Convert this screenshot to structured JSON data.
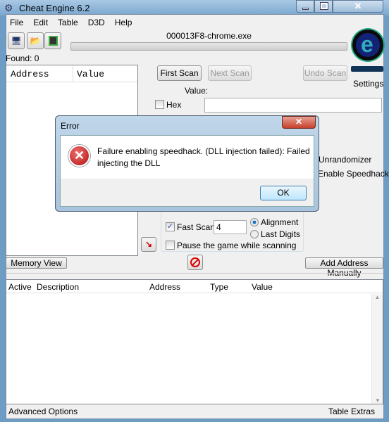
{
  "window": {
    "title": "Cheat Engine 6.2",
    "controls": [
      "minimize",
      "maximize",
      "close"
    ]
  },
  "menu": [
    "File",
    "Edit",
    "Table",
    "D3D",
    "Help"
  ],
  "process": "000013F8-chrome.exe",
  "progress": 0,
  "found": "Found: 0",
  "results_columns": [
    "Address",
    "Value"
  ],
  "scan": {
    "first": "First Scan",
    "next": "Next Scan",
    "undo": "Undo Scan",
    "value_label": "Value:",
    "hex": "Hex",
    "settings": "Settings",
    "unrandomizer": "Unrandomizer",
    "speedhack": "Enable Speedhack",
    "fast_scan": "Fast Scan",
    "fast_scan_value": "4",
    "alignment": "Alignment",
    "last_digits": "Last Digits",
    "pause": "Pause the game while scanning",
    "fast_scan_checked": true,
    "alignment_selected": true
  },
  "buttons": {
    "memory_view": "Memory View",
    "add_address": "Add Address Manually"
  },
  "table_columns": [
    "Active",
    "Description",
    "Address",
    "Type",
    "Value"
  ],
  "footer": {
    "advanced": "Advanced Options",
    "extras": "Table Extras"
  },
  "dialog": {
    "title": "Error",
    "message_line1": "Failure enabling speedhack. (DLL injection failed): Failed",
    "message_line2": "injecting the DLL",
    "ok": "OK",
    "icon": "error-icon"
  }
}
